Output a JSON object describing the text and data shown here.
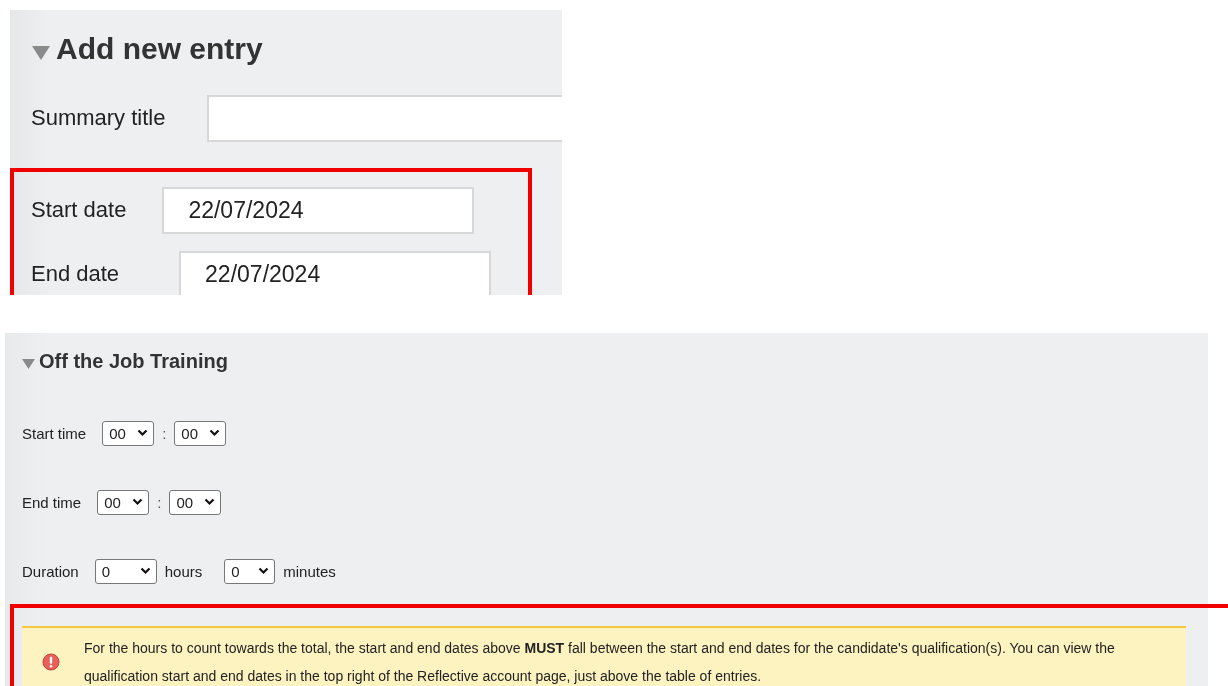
{
  "entry_panel": {
    "title": "Add new entry",
    "expanded": true,
    "summary": {
      "label": "Summary title"
    },
    "dates": {
      "highlighted": true,
      "fields": [
        {
          "label": "Start date",
          "value": "22/07/2024"
        },
        {
          "label": "End date",
          "value": "22/07/2024"
        }
      ]
    }
  },
  "training_panel": {
    "title": "Off the Job Training",
    "expanded": true,
    "rows": [
      {
        "kind": "time",
        "label": "Start time",
        "hour": "00",
        "separator": ":",
        "minute": "00"
      },
      {
        "kind": "time",
        "label": "End time",
        "hour": "00",
        "separator": ":",
        "minute": "00"
      },
      {
        "kind": "duration",
        "label": "Duration",
        "hours": "0",
        "hours_unit": "hours",
        "minutes": "0",
        "minutes_unit": "minutes"
      }
    ],
    "notice": {
      "highlighted": true,
      "text": "For the hours to count towards the total, the start and end dates above **MUST** fall between the start and end dates for the candidate's qualification(s). You can view the qualification start and end dates in the top right of the Reflective account page, just above the table of entries."
    }
  }
}
